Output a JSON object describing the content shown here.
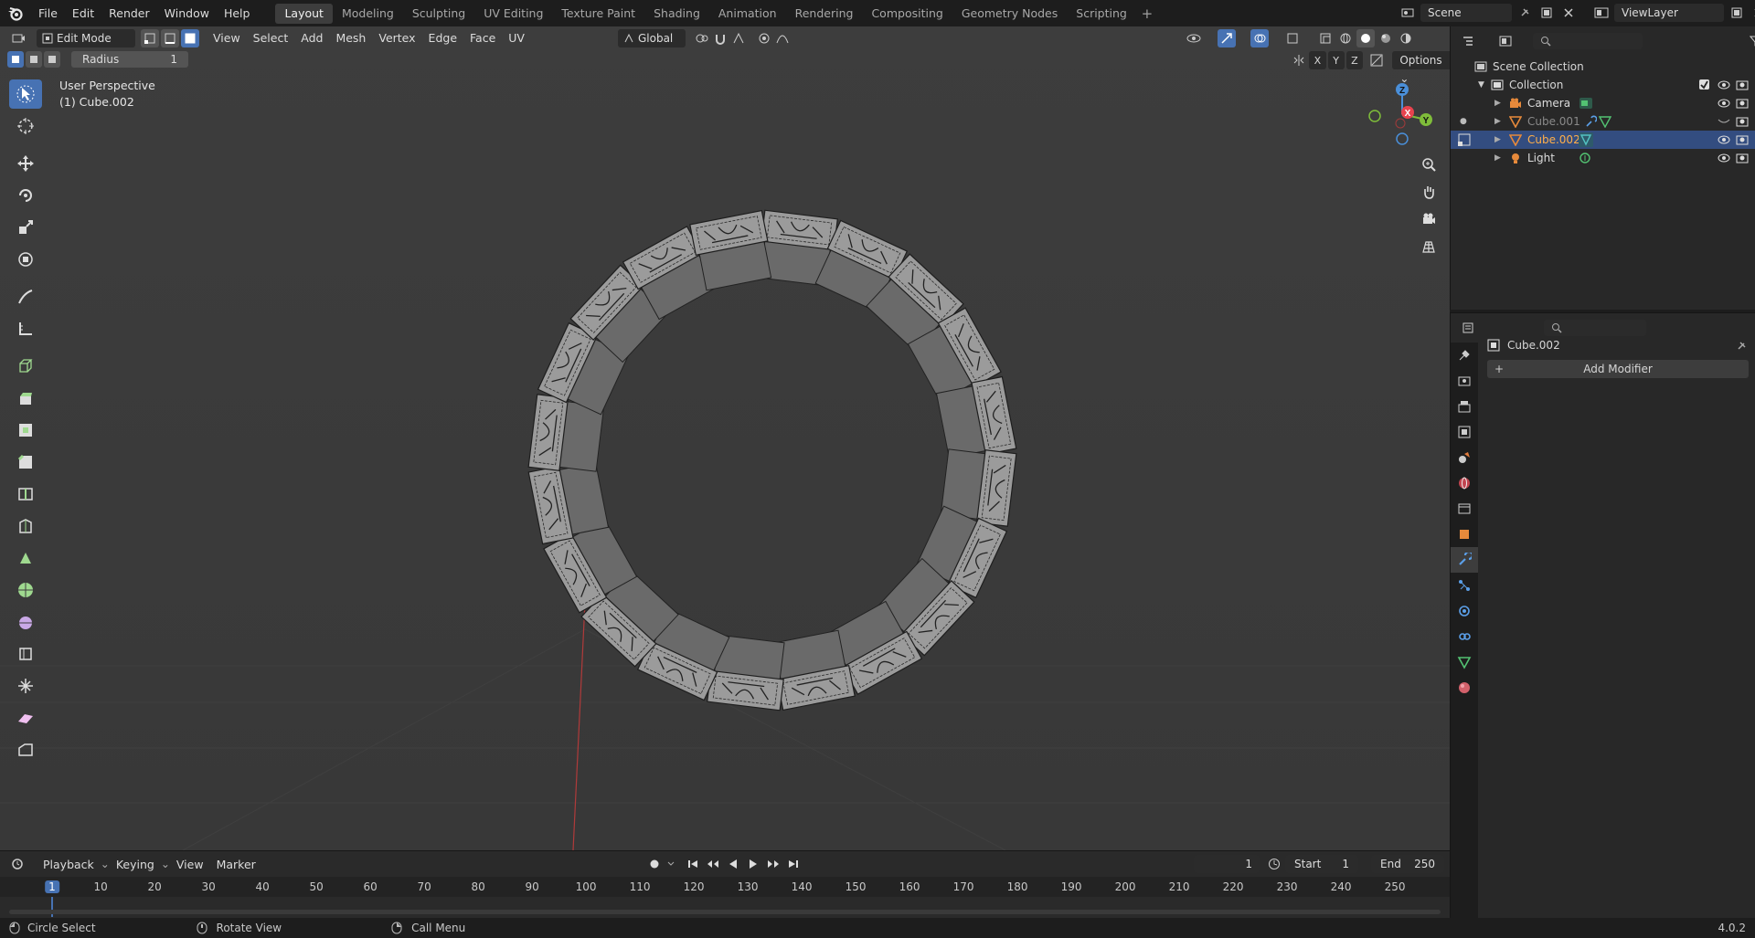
{
  "menu": [
    "File",
    "Edit",
    "Render",
    "Window",
    "Help"
  ],
  "workspaces": [
    "Layout",
    "Modeling",
    "Sculpting",
    "UV Editing",
    "Texture Paint",
    "Shading",
    "Animation",
    "Rendering",
    "Compositing",
    "Geometry Nodes",
    "Scripting"
  ],
  "active_workspace": "Layout",
  "scene_name": "Scene",
  "view_layer": "ViewLayer",
  "viewport": {
    "mode": "Edit Mode",
    "header_menus": [
      "View",
      "Select",
      "Add",
      "Mesh",
      "Vertex",
      "Edge",
      "Face",
      "UV"
    ],
    "transform_orientation": "Global",
    "options_label": "Options",
    "axis_labels": [
      "X",
      "Y",
      "Z"
    ],
    "tool_setting_label": "Radius",
    "tool_setting_value": "1",
    "perspective_text": "User Perspective",
    "object_text": "(1) Cube.002",
    "gizmo": {
      "x": "X",
      "y": "Y",
      "z": "Z"
    }
  },
  "outliner": {
    "root": "Scene Collection",
    "collection": "Collection",
    "items": [
      {
        "name": "Camera",
        "type": "camera"
      },
      {
        "name": "Cube.001",
        "type": "mesh"
      },
      {
        "name": "Cube.002",
        "type": "mesh",
        "selected": true
      },
      {
        "name": "Light",
        "type": "light"
      }
    ]
  },
  "properties": {
    "object_name": "Cube.002",
    "add_modifier": "Add Modifier"
  },
  "timeline": {
    "menus": [
      "Playback",
      "Keying",
      "View",
      "Marker"
    ],
    "current_frame": "1",
    "start_label": "Start",
    "start": "1",
    "end_label": "End",
    "end": "250",
    "ticks": [
      "1",
      "10",
      "20",
      "30",
      "40",
      "50",
      "60",
      "70",
      "80",
      "90",
      "100",
      "110",
      "120",
      "130",
      "140",
      "150",
      "160",
      "170",
      "180",
      "190",
      "200",
      "210",
      "220",
      "230",
      "240",
      "250"
    ]
  },
  "status": {
    "left": "Circle Select",
    "middle": "Rotate View",
    "right": "Call Menu",
    "version": "4.0.2"
  },
  "colors": {
    "accent": "#4772b3",
    "selected_row": "#334d80",
    "x_axis": "#e8434e",
    "y_axis": "#7fbd3a",
    "z_axis": "#4a8fd9"
  }
}
